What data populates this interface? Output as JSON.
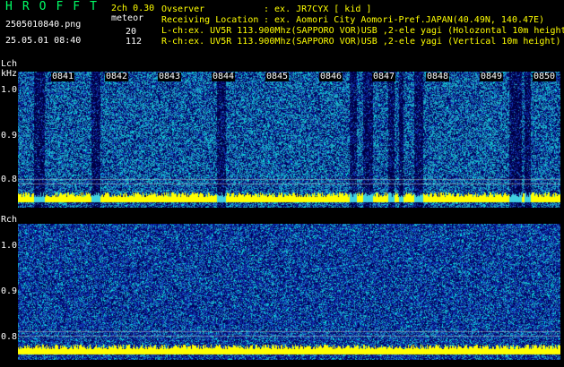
{
  "header": {
    "logo": "HROFFT",
    "version": "2ch 0.30",
    "mode": "meteor",
    "filename": "2505010840.png",
    "count_l": "20",
    "count_r": "112",
    "datetime": "25.05.01 08:40",
    "observer_label": "Ovserver",
    "observer_value": ": ex. JR7CYX [ kid ]",
    "location_label": "Receiving Location",
    "location_value": ": ex. Aomori City Aomori-Pref.JAPAN(40.49N, 140.47E)",
    "lch_info": "L-ch:ex. UV5R 113.900Mhz(SAPPORO VOR)USB ,2-ele yagi (Holozontal 10m height)",
    "rch_info": "R-ch:ex. UV5R 113.900Mhz(SAPPORO VOR)USB ,2-ele yagi (Vertical 10m height)"
  },
  "lch": {
    "label": "Lch",
    "unit": "kHz",
    "ticks": [
      "1.0",
      "0.9",
      "0.8"
    ],
    "minutes": [
      "0841",
      "0842",
      "0843",
      "0844",
      "0845",
      "0846",
      "0847",
      "0848",
      "0849",
      "0850"
    ]
  },
  "rch": {
    "label": "Rch",
    "ticks": [
      "1.0",
      "0.9",
      "0.8"
    ]
  },
  "colors": {
    "yellow": "#ffff00",
    "cyan": "#00ffff",
    "noise_dark": "#000066",
    "noise_mid": "#1030b0",
    "noise_light": "#20a0c0"
  }
}
